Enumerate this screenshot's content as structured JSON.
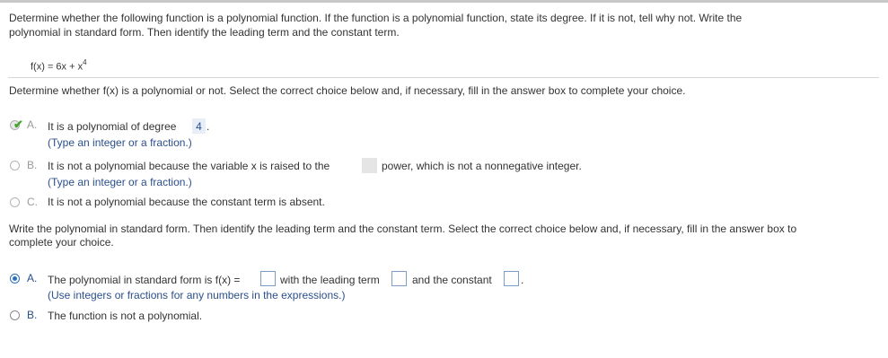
{
  "instructions": {
    "line1": "Determine whether the following function is a polynomial function. If the function is a polynomial function, state its degree. If it is not, tell why not. Write the",
    "line2": "polynomial in standard form. Then identify the leading term and the constant term."
  },
  "function": {
    "lhs": "f(x) = 6x + x",
    "exponent": "4"
  },
  "part1": {
    "prompt": "Determine whether f(x) is a polynomial or not. Select the correct choice below and, if necessary, fill in the answer box to complete your choice.",
    "choices": [
      {
        "letter": "A.",
        "text": "It is a polynomial of degree",
        "answer": "4",
        "after": ".",
        "hint": "(Type an integer or a fraction.)",
        "state": "correct"
      },
      {
        "letter": "B.",
        "text": "It is not a polynomial because the variable x is raised to the",
        "after": "power, which is not a nonnegative integer.",
        "hint": "(Type an integer or a fraction.)",
        "state": "unselected"
      },
      {
        "letter": "C.",
        "text": "It is not a polynomial because the constant term is absent.",
        "state": "unselected"
      }
    ]
  },
  "part2": {
    "prompt_line1": "Write the polynomial in standard form. Then identify the leading term and the constant term. Select the correct choice below and, if necessary, fill in the answer box to",
    "prompt_line2": "complete your choice.",
    "choices": [
      {
        "letter": "A.",
        "text": "The polynomial in standard form is f(x) =",
        "middle": "with the leading term",
        "end": "and the constant",
        "after": ".",
        "hint": "(Use integers or fractions for any numbers in the expressions.)",
        "state": "selected"
      },
      {
        "letter": "B.",
        "text": "The function is not a polynomial.",
        "state": "unselected"
      }
    ]
  },
  "colors": {
    "accent": "#2b6fc0",
    "check": "#45a52b",
    "hint": "#2b4f8a"
  }
}
